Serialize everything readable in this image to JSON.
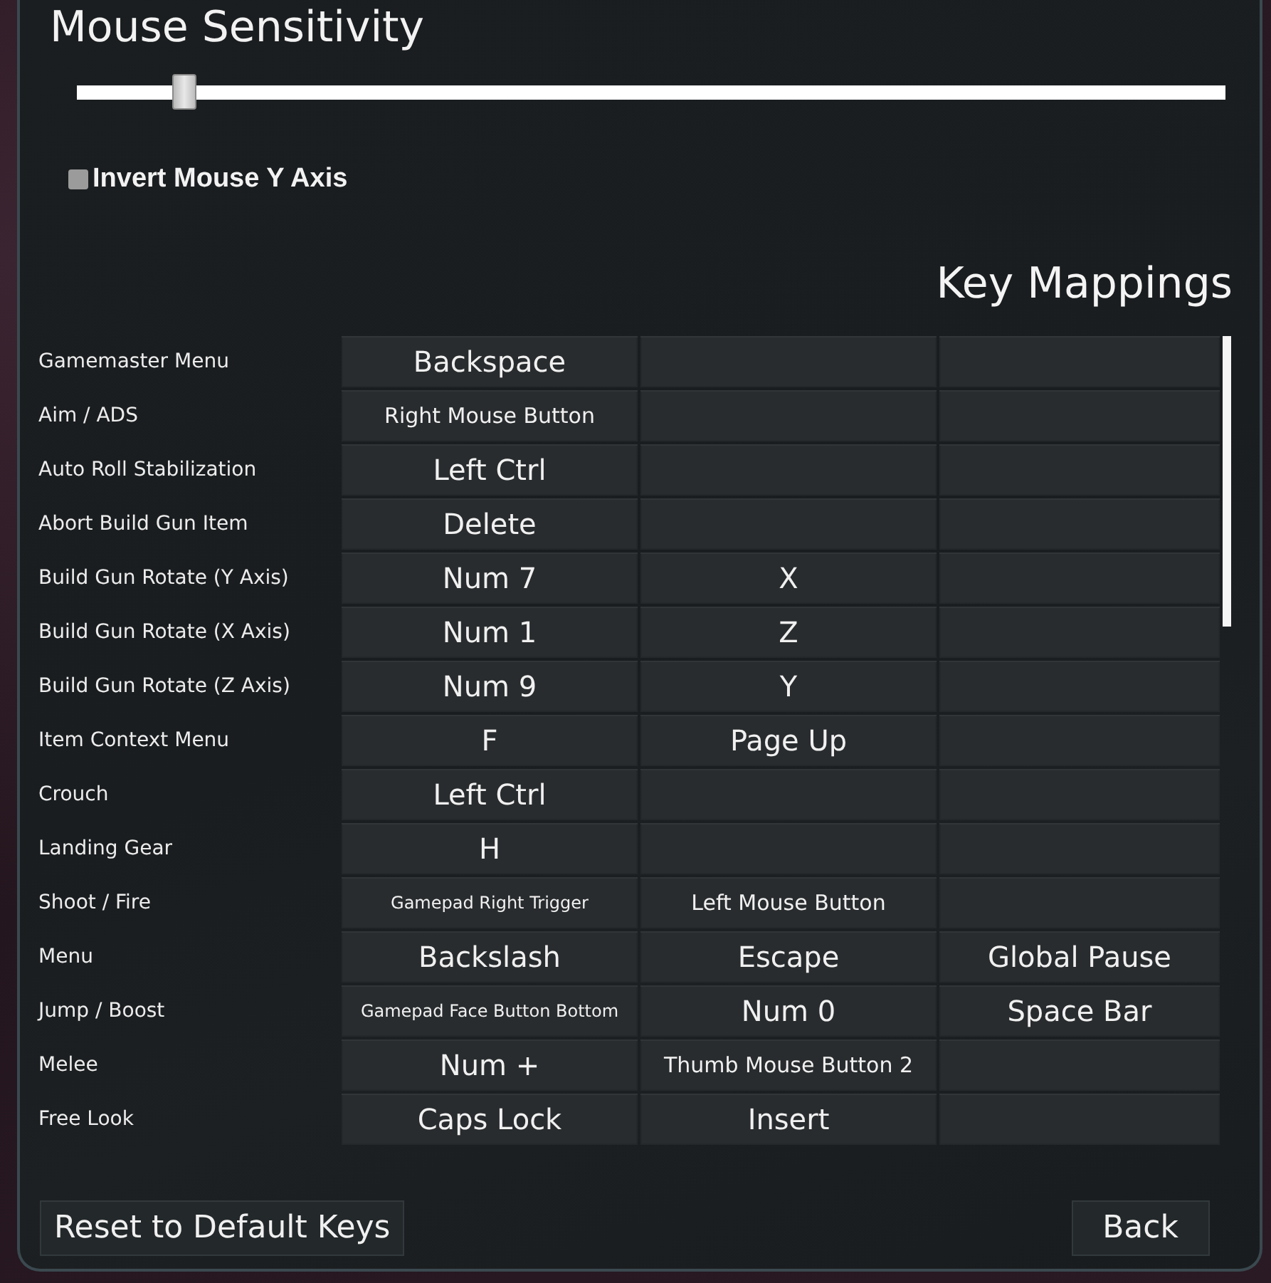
{
  "sensitivity": {
    "title": "Mouse Sensitivity",
    "level": 0.085
  },
  "invert_y": {
    "label": "Invert Mouse Y Axis",
    "checked": false
  },
  "key_mappings": {
    "title": "Key Mappings",
    "rows": [
      {
        "action": "Gamemaster Menu",
        "key_1": "Backspace"
      },
      {
        "action": "Aim / ADS",
        "key_1": "Right Mouse Button"
      },
      {
        "action": "Auto Roll Stabilization",
        "key_1": "Left Ctrl"
      },
      {
        "action": "Abort Build Gun Item",
        "key_1": "Delete"
      },
      {
        "action": "Build Gun Rotate (Y Axis)",
        "key_1": "Num 7",
        "key_2": "X"
      },
      {
        "action": "Build Gun Rotate (X Axis)",
        "key_1": "Num 1",
        "key_2": "Z"
      },
      {
        "action": "Build Gun Rotate (Z Axis)",
        "key_1": "Num 9",
        "key_2": "Y"
      },
      {
        "action": "Item Context Menu",
        "key_1": "F",
        "key_2": "Page Up"
      },
      {
        "action": "Crouch",
        "key_1": "Left Ctrl"
      },
      {
        "action": "Landing Gear",
        "key_1": "H"
      },
      {
        "action": "Shoot / Fire",
        "key_1": "Gamepad Right Trigger",
        "key_2": "Left Mouse Button"
      },
      {
        "action": "Menu",
        "key_1": "Backslash",
        "key_2": "Escape",
        "key_3": "Global Pause"
      },
      {
        "action": "Jump / Boost",
        "key_1": "Gamepad Face Button Bottom",
        "key_2": "Num 0",
        "key_3": "Space Bar"
      },
      {
        "action": "Melee",
        "key_1": "Num +",
        "key_2": "Thumb Mouse Button 2"
      },
      {
        "action": "Free Look",
        "key_1": "Caps Lock",
        "key_2": "Insert"
      }
    ]
  },
  "buttons": [
    {
      "label": "Reset to Default Keys"
    },
    {
      "label": "Back"
    }
  ]
}
